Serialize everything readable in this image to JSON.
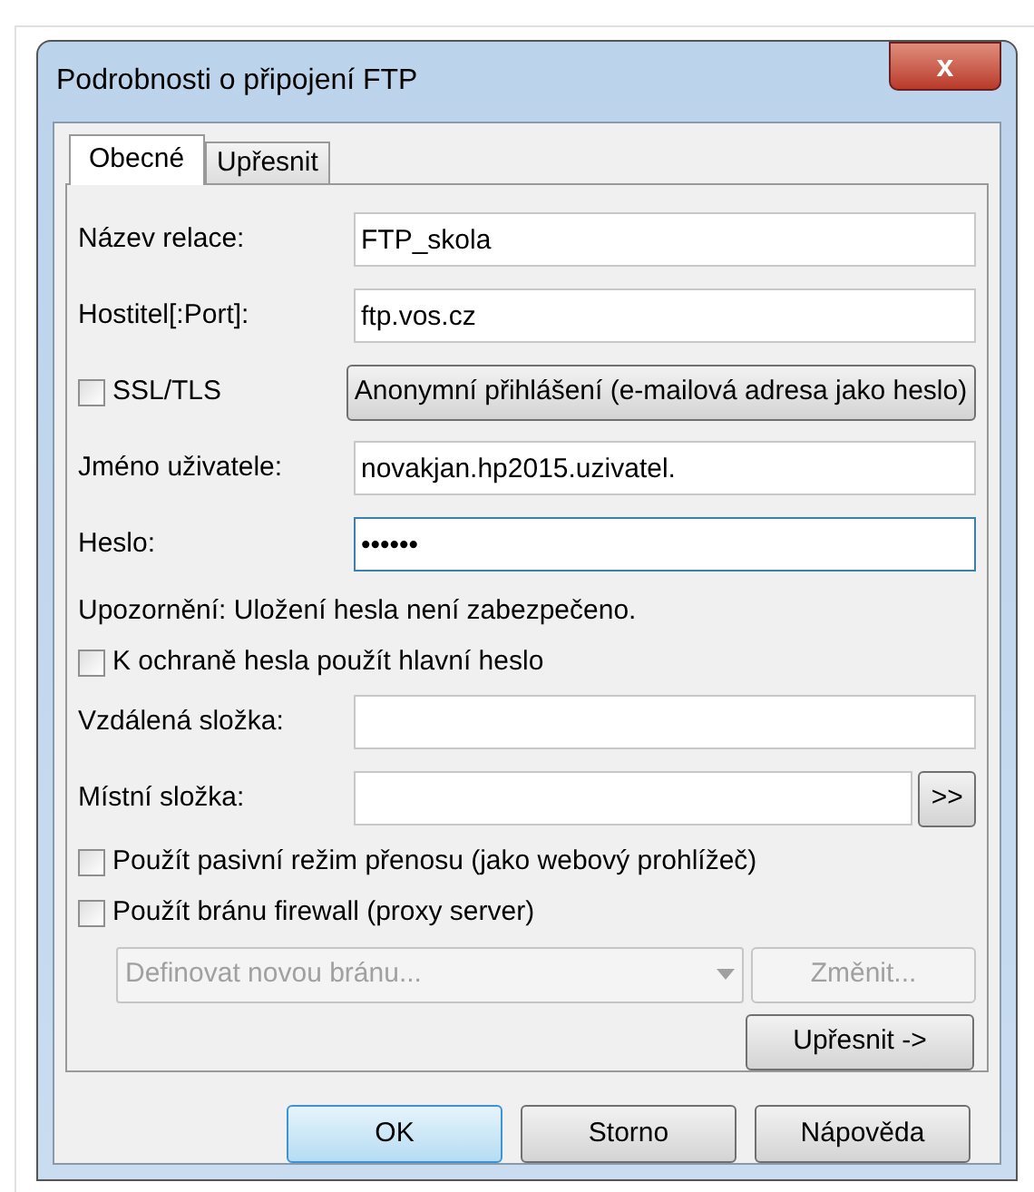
{
  "window": {
    "title": "Podrobnosti o připojení FTP",
    "close": "x"
  },
  "tabs": [
    {
      "label": "Obecné",
      "selected": true
    },
    {
      "label": "Upřesnit",
      "selected": false
    }
  ],
  "rows": [
    {
      "kind": "field",
      "label": "Název relace:",
      "value": "FTP_skola",
      "focused": false
    },
    {
      "kind": "field",
      "label": "Hostitel[:Port]:",
      "value": "ftp.vos.cz",
      "focused": false
    },
    {
      "kind": "check_button",
      "label": "SSL/TLS",
      "checked": false,
      "button": "Anonymní přihlášení (e-mailová adresa jako heslo)"
    },
    {
      "kind": "field",
      "label": "Jméno uživatele:",
      "value": "novakjan.hp2015.uzivatel.",
      "focused": false
    },
    {
      "kind": "field",
      "label": "Heslo:",
      "value": "••••••",
      "focused": true
    },
    {
      "kind": "note",
      "text": "Upozornění: Uložení hesla není zabezpečeno."
    },
    {
      "kind": "check",
      "label": "K ochraně hesla použít hlavní heslo",
      "checked": false
    },
    {
      "kind": "field",
      "label": "Vzdálená složka:",
      "focused": false
    },
    {
      "kind": "field_button",
      "label": "Místní složka:",
      "focused": false,
      "button": ">>"
    },
    {
      "kind": "check",
      "label": "Použít pasivní režim přenosu (jako webový prohlížeč)",
      "checked": false
    },
    {
      "kind": "check",
      "label": "Použít bránu firewall (proxy server)",
      "checked": false
    },
    {
      "kind": "combo",
      "value": "Definovat novou bránu...",
      "disabled": true,
      "button": "Změnit...",
      "button_disabled": true
    },
    {
      "kind": "button",
      "button": "Upřesnit ->"
    }
  ],
  "buttons": [
    {
      "label": "OK",
      "default": true
    },
    {
      "label": "Storno",
      "default": false
    },
    {
      "label": "Nápověda",
      "default": false
    }
  ]
}
